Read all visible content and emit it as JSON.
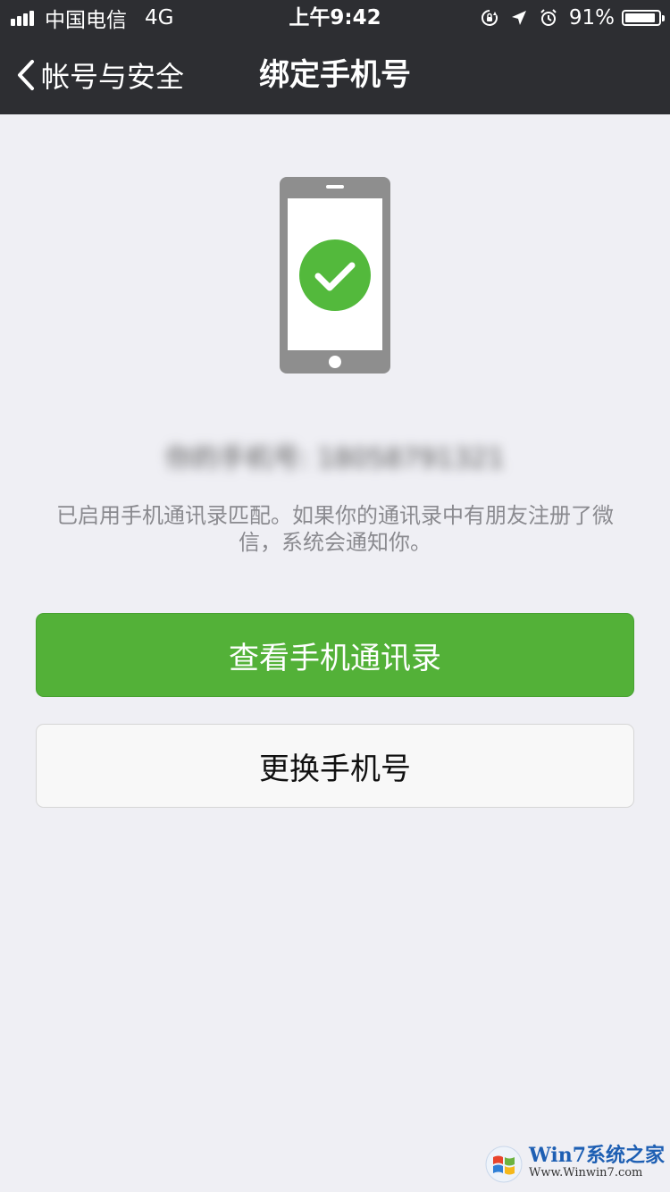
{
  "status_bar": {
    "carrier": "中国电信",
    "network": "4G",
    "time": "上午9:42",
    "battery": "91%",
    "battery_level": 0.91,
    "icons": [
      "signal-icon",
      "orientation-lock-icon",
      "location-icon",
      "alarm-icon",
      "battery-icon"
    ]
  },
  "nav": {
    "back_label": "帐号与安全",
    "title": "绑定手机号"
  },
  "content": {
    "phone_icon": "phone-check-icon",
    "phone_number": "你的手机号: 18058791321",
    "hint": "已启用手机通讯录匹配。如果你的通讯录中有朋友注册了微信，系统会通知你。"
  },
  "buttons": {
    "view_contacts": "查看手机通讯录",
    "change_number": "更换手机号"
  },
  "watermark": {
    "brand": "Win7系统之家",
    "url": "Www.Winwin7.com"
  },
  "colors": {
    "nav_bg": "#2d2e32",
    "primary_green": "#53b138",
    "check_green": "#53b93c",
    "page_bg": "#efeff4"
  }
}
